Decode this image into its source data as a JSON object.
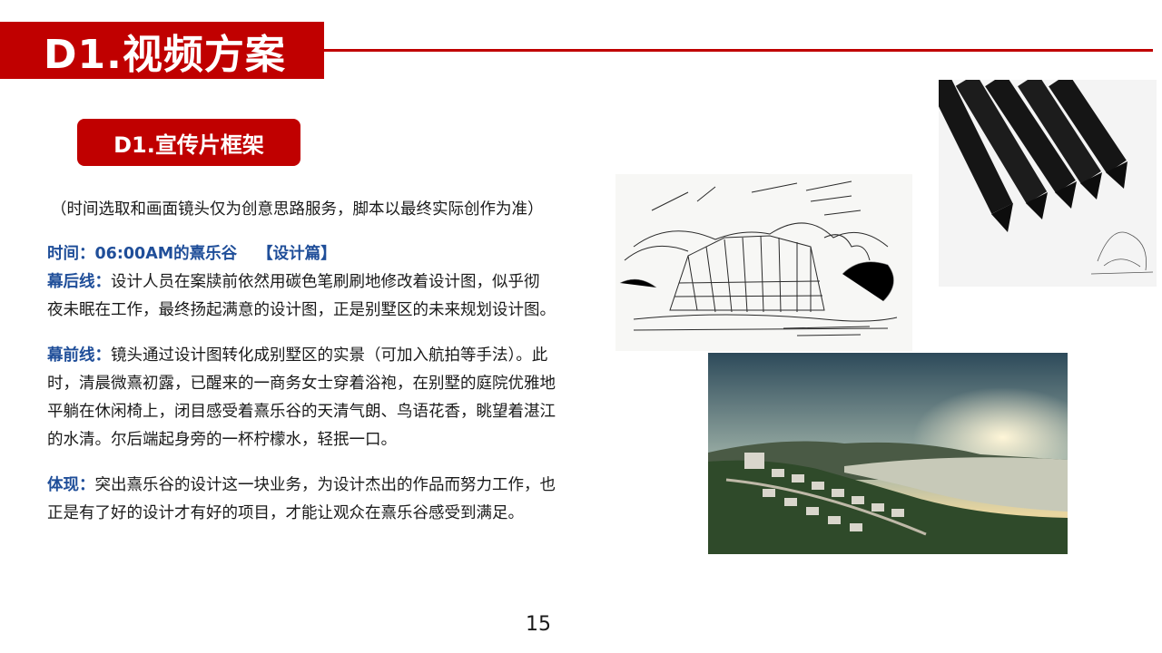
{
  "header": {
    "title": "D1.视频方案"
  },
  "section": {
    "label": "D1.宣传片框架"
  },
  "content": {
    "note": "（时间选取和画面镜头仅为创意思路服务，脚本以最终实际创作为准）",
    "time_line": {
      "label": "时间：06:00AM的熹乐谷",
      "tag": "【设计篇】"
    },
    "backstage": {
      "label": "幕后线：",
      "line1": "设计人员在案牍前依然用碳色笔刷刷地修改着设计图，似乎彻",
      "line2": "夜未眠在工作，最终扬起满意的设计图，正是别墅区的未来规划设计图。"
    },
    "frontstage": {
      "label": "幕前线：",
      "line1": "镜头通过设计图转化成别墅区的实景（可加入航拍等手法）。此",
      "line2": "时，清晨微熹初露，已醒来的一商务女士穿着浴袍，在别墅的庭院优雅地",
      "line3": "平躺在休闲椅上，闭目感受着熹乐谷的天清气朗、鸟语花香，眺望着湛江",
      "line4": "的水清。尔后端起身旁的一杯柠檬水，轻抿一口。"
    },
    "embody": {
      "label": "体现：",
      "line1": "突出熹乐谷的设计这一块业务，为设计杰出的作品而努力工作，也",
      "line2": "正是有了好的设计才有好的项目，才能让观众在熹乐谷感受到满足。"
    }
  },
  "footer": {
    "page_number": "15"
  },
  "colors": {
    "accent_red": "#c00000",
    "label_blue": "#1f4e99"
  }
}
